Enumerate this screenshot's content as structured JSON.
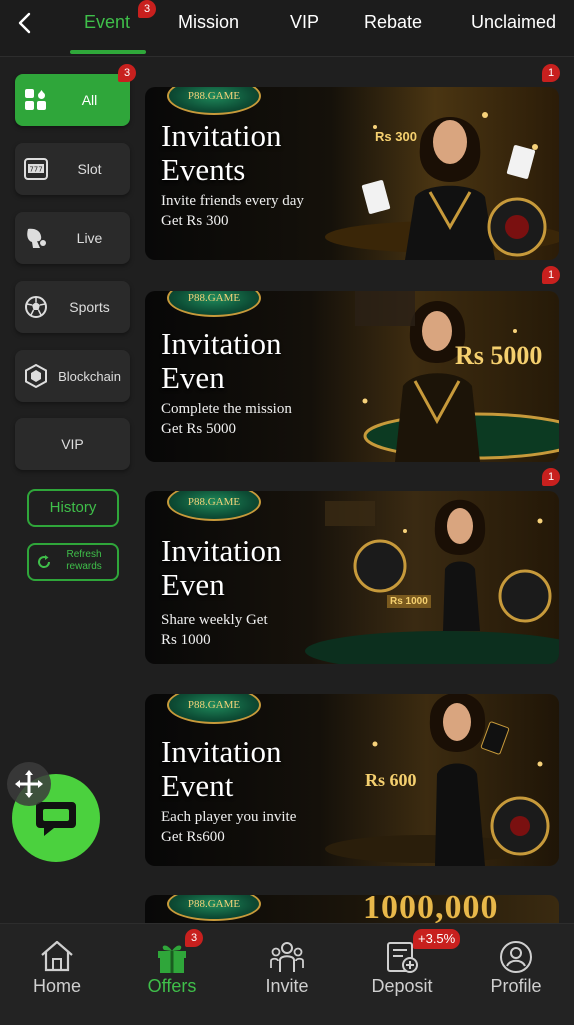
{
  "topnav": {
    "tabs": [
      {
        "label": "Event",
        "badge": "3"
      },
      {
        "label": "Mission"
      },
      {
        "label": "VIP"
      },
      {
        "label": "Rebate"
      },
      {
        "label": "Unclaimed"
      }
    ]
  },
  "sidebar": {
    "items": [
      {
        "label": "All",
        "badge": "3",
        "icon": "grid-icon"
      },
      {
        "label": "Slot",
        "icon": "slot-machine-icon"
      },
      {
        "label": "Live",
        "icon": "live-dealer-icon"
      },
      {
        "label": "Sports",
        "icon": "soccer-ball-icon"
      },
      {
        "label": "Blockchain",
        "icon": "cube-icon"
      },
      {
        "label": "VIP"
      }
    ],
    "history_label": "History",
    "refresh_label": "Refresh\nrewards"
  },
  "banners": [
    {
      "logo": "P88.GAME",
      "title": "Invitation\nEvents",
      "subtitle": "Invite friends every day\nGet Rs 300",
      "badge": "1",
      "amount": "Rs 300"
    },
    {
      "logo": "P88.GAME",
      "title": "Invitation\nEven",
      "subtitle": "Complete the mission\nGet Rs 5000",
      "badge": "1",
      "amount": "Rs 5000"
    },
    {
      "logo": "P88.GAME",
      "title": "Invitation\nEven",
      "subtitle": "Share weekly Get\nRs 1000",
      "badge": "1",
      "amount": "Rs 1000"
    },
    {
      "logo": "P88.GAME",
      "title": "Invitation\nEvent",
      "subtitle": "Each player you invite\nGet Rs600",
      "amount": "Rs 600"
    },
    {
      "logo": "P88.GAME",
      "amount": "1000,000"
    }
  ],
  "bottomnav": {
    "items": [
      {
        "label": "Home",
        "icon": "home-icon"
      },
      {
        "label": "Offers",
        "icon": "gift-icon",
        "badge": "3"
      },
      {
        "label": "Invite",
        "icon": "invite-people-icon"
      },
      {
        "label": "Deposit",
        "icon": "deposit-icon",
        "badge": "+3.5%"
      },
      {
        "label": "Profile",
        "icon": "profile-icon"
      }
    ]
  },
  "colors": {
    "accent": "#2fa63a",
    "badge": "#c8201e",
    "background": "#1f1f1f"
  }
}
